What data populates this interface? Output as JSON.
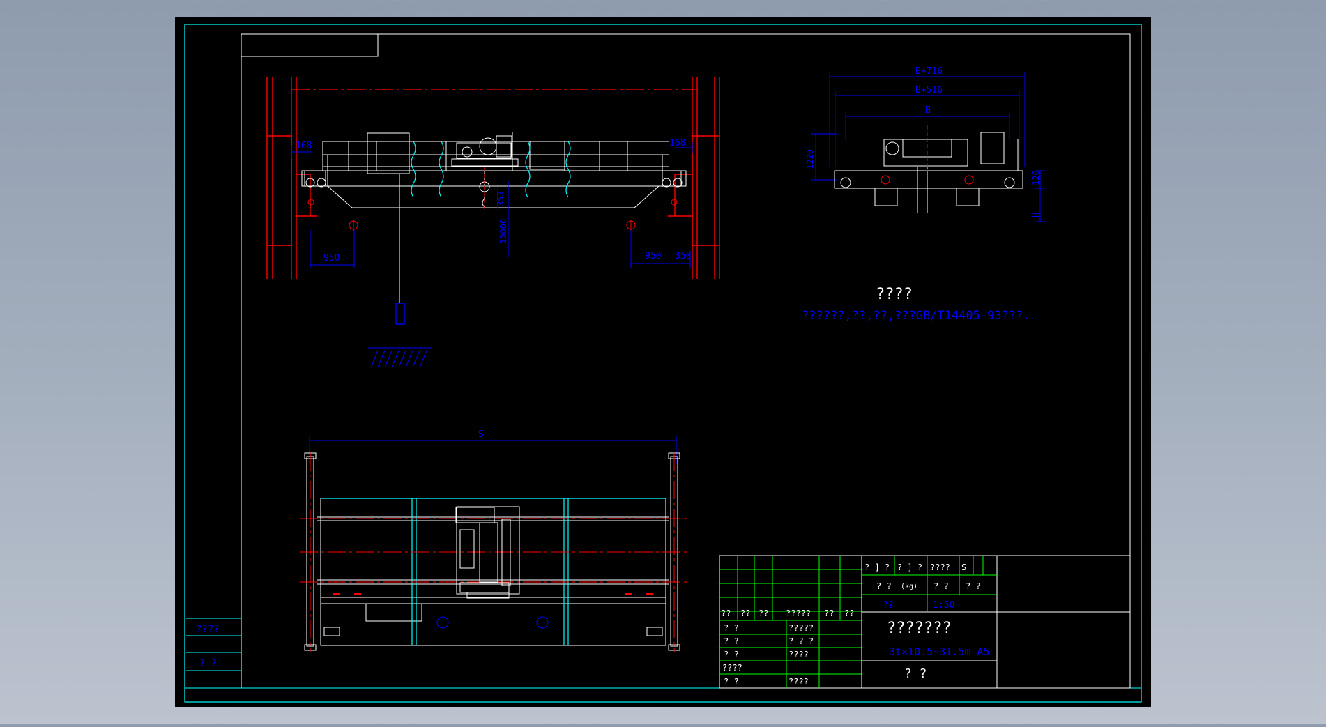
{
  "dims": {
    "front": {
      "left_168": "168",
      "right_168": "168",
      "left_950": "950",
      "right_950": "950",
      "right_350": "350",
      "hook_353": "353",
      "height_10000": "10000"
    },
    "side": {
      "b716": "B+716",
      "b516": "B+516",
      "b": "B",
      "h1220": "1220",
      "h120": "120",
      "h": "H"
    },
    "plan": {
      "span": "S"
    }
  },
  "notes": {
    "title": "????",
    "body": "??????,??,??,???GB/T14405-93???."
  },
  "title_block": {
    "left_grid_headers": [
      "??",
      "??",
      "??",
      "?????",
      "??",
      "??"
    ],
    "left_rows": [
      {
        "a": "? ?",
        "b": "?????"
      },
      {
        "a": "? ?",
        "b": "? ? ?"
      },
      {
        "a": "? ?",
        "b": "????"
      },
      {
        "a": "????",
        "b": ""
      },
      {
        "a": "? ?",
        "b": "????"
      }
    ],
    "info_row1": [
      "? ] ?",
      "? ] ?",
      "????",
      "S"
    ],
    "info_row2_a": "? ?",
    "info_row2_unit": "(kg)",
    "info_row2_b": "? ?",
    "info_row2_c": "?  ?",
    "info_row3_a": "??",
    "info_row3_b": "1:50",
    "drawing_name": "???????",
    "drawing_model": "3t×10.5~31.5m A5",
    "company": "?   ?"
  },
  "left_strip": {
    "label1": "????",
    "label2": "?   ?"
  },
  "colors": {
    "background": "#000000",
    "frame": "#ffffff",
    "border": "#00ffff",
    "dimension": "#0000ff",
    "centerline": "#ff0000",
    "table": "#00ff00",
    "text": "#ffffff"
  }
}
